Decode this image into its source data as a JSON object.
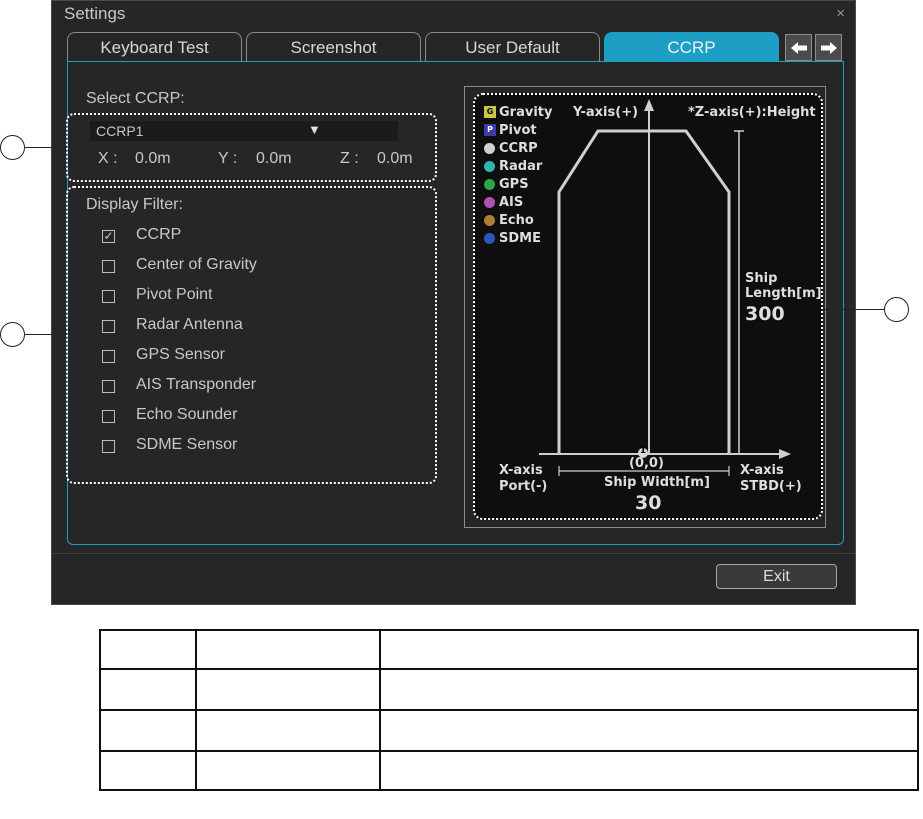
{
  "window": {
    "title": "Settings",
    "close_glyph": "×"
  },
  "tabs": [
    {
      "label": "Keyboard Test",
      "active": false
    },
    {
      "label": "Screenshot",
      "active": false
    },
    {
      "label": "User Default",
      "active": false
    },
    {
      "label": "CCRP",
      "active": true
    }
  ],
  "nav": {
    "left_icon": "arrow-left-icon",
    "right_icon": "arrow-right-icon"
  },
  "ccrp": {
    "select_label": "Select CCRP:",
    "selected": "CCRP1",
    "x_label": "X :",
    "x_value": "0.0m",
    "y_label": "Y :",
    "y_value": "0.0m",
    "z_label": "Z :",
    "z_value": "0.0m"
  },
  "filter": {
    "label": "Display Filter:",
    "items": [
      {
        "label": "CCRP",
        "checked": true
      },
      {
        "label": "Center of Gravity",
        "checked": false
      },
      {
        "label": "Pivot Point",
        "checked": false
      },
      {
        "label": "Radar Antenna",
        "checked": false
      },
      {
        "label": "GPS Sensor",
        "checked": false
      },
      {
        "label": "AIS Transponder",
        "checked": false
      },
      {
        "label": "Echo Sounder",
        "checked": false
      },
      {
        "label": "SDME Sensor",
        "checked": false
      }
    ]
  },
  "diagram": {
    "legend": [
      {
        "marker": "G",
        "label": "Gravity",
        "color": "#c8c83a"
      },
      {
        "marker": "P",
        "label": "Pivot",
        "color": "#3a3ab0"
      },
      {
        "label": "CCRP",
        "color": "#d0d0d0"
      },
      {
        "label": "Radar",
        "color": "#2ab5b0"
      },
      {
        "label": "GPS",
        "color": "#2aa848"
      },
      {
        "label": "AIS",
        "color": "#b050b8"
      },
      {
        "label": "Echo",
        "color": "#b08030"
      },
      {
        "label": "SDME",
        "color": "#2a58b8"
      }
    ],
    "y_axis_label": "Y-axis(+)",
    "z_axis_label": "*Z-axis(+):Height",
    "ship_length_label_1": "Ship",
    "ship_length_label_2": "Length[m]",
    "ship_length_value": "300",
    "origin_marker": "1",
    "origin_label": "(0,0)",
    "x_axis_port_1": "X-axis",
    "x_axis_port_2": "Port(-)",
    "x_axis_stbd_1": "X-axis",
    "x_axis_stbd_2": "STBD(+)",
    "ship_width_label": "Ship Width[m]",
    "ship_width_value": "30"
  },
  "footer": {
    "exit_label": "Exit"
  },
  "colors": {
    "accent": "#1d9fc5",
    "background": "#262626"
  }
}
